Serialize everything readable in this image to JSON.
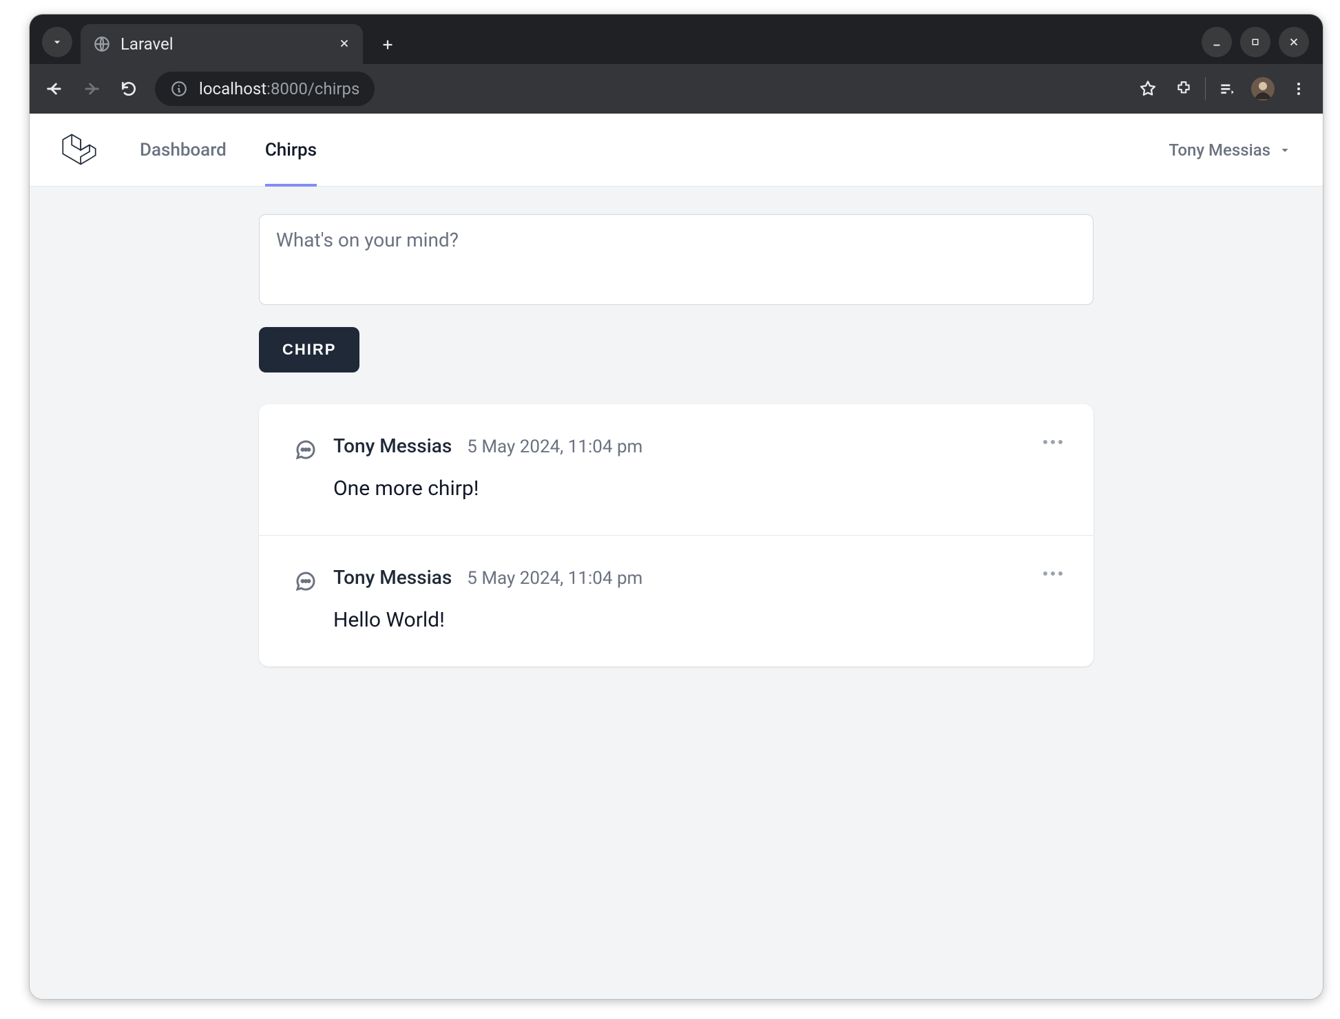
{
  "browser": {
    "tab_title": "Laravel",
    "url_host": "localhost",
    "url_rest": ":8000/chirps"
  },
  "app": {
    "nav": {
      "dashboard": "Dashboard",
      "chirps": "Chirps"
    },
    "user_menu": {
      "name": "Tony Messias"
    }
  },
  "composer": {
    "placeholder": "What's on your mind?",
    "submit_label": "Chirp"
  },
  "chirps": [
    {
      "author": "Tony Messias",
      "time": "5 May 2024, 11:04 pm",
      "text": "One more chirp!"
    },
    {
      "author": "Tony Messias",
      "time": "5 May 2024, 11:04 pm",
      "text": "Hello World!"
    }
  ]
}
